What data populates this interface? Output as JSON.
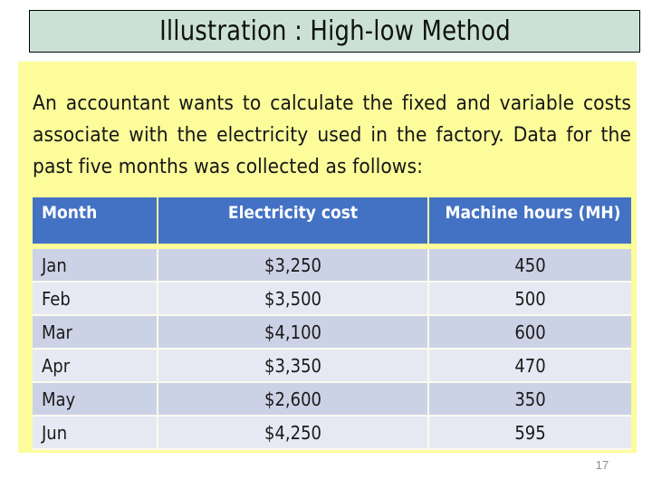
{
  "slide": {
    "title": "Illustration : High-low Method",
    "body_paragraph": "An accountant wants to calculate the fixed and variable costs associate with the electricity used in the factory. Data for the past five months was collected as follows:",
    "page_number": "17",
    "colors": {
      "title_background": "#cbe1d6",
      "title_border": "#000000",
      "content_background": "#fcfc9b",
      "table_header_background": "#4372c4",
      "table_header_text": "#ffffff",
      "row_dark": "#ccd2e6",
      "row_light": "#e6e9f3",
      "body_text": "#161616",
      "page_number_text": "#8d8d8d"
    }
  },
  "table": {
    "headers": [
      "Month",
      "Electricity cost",
      "Machine hours (MH)"
    ],
    "rows": [
      {
        "month": "Jan",
        "cost": "$3,250",
        "hours": "450"
      },
      {
        "month": "Feb",
        "cost": "$3,500",
        "hours": "500"
      },
      {
        "month": "Mar",
        "cost": "$4,100",
        "hours": "600"
      },
      {
        "month": "Apr",
        "cost": "$3,350",
        "hours": "470"
      },
      {
        "month": "May",
        "cost": "$2,600",
        "hours": "350"
      },
      {
        "month": "Jun",
        "cost": "$4,250",
        "hours": "595"
      }
    ]
  },
  "chart_data": {
    "type": "table",
    "title": "Illustration : High-low Method",
    "columns": [
      "Month",
      "Electricity cost",
      "Machine hours (MH)"
    ],
    "categories": [
      "Jan",
      "Feb",
      "Mar",
      "Apr",
      "May",
      "Jun"
    ],
    "series": [
      {
        "name": "Electricity cost",
        "values": [
          3250,
          3500,
          4100,
          3350,
          2600,
          4250
        ],
        "unit": "$"
      },
      {
        "name": "Machine hours (MH)",
        "values": [
          450,
          500,
          600,
          470,
          350,
          595
        ],
        "unit": "MH"
      }
    ],
    "xlabel": "Month",
    "ylabel": "",
    "grid": false,
    "legend": "none"
  }
}
